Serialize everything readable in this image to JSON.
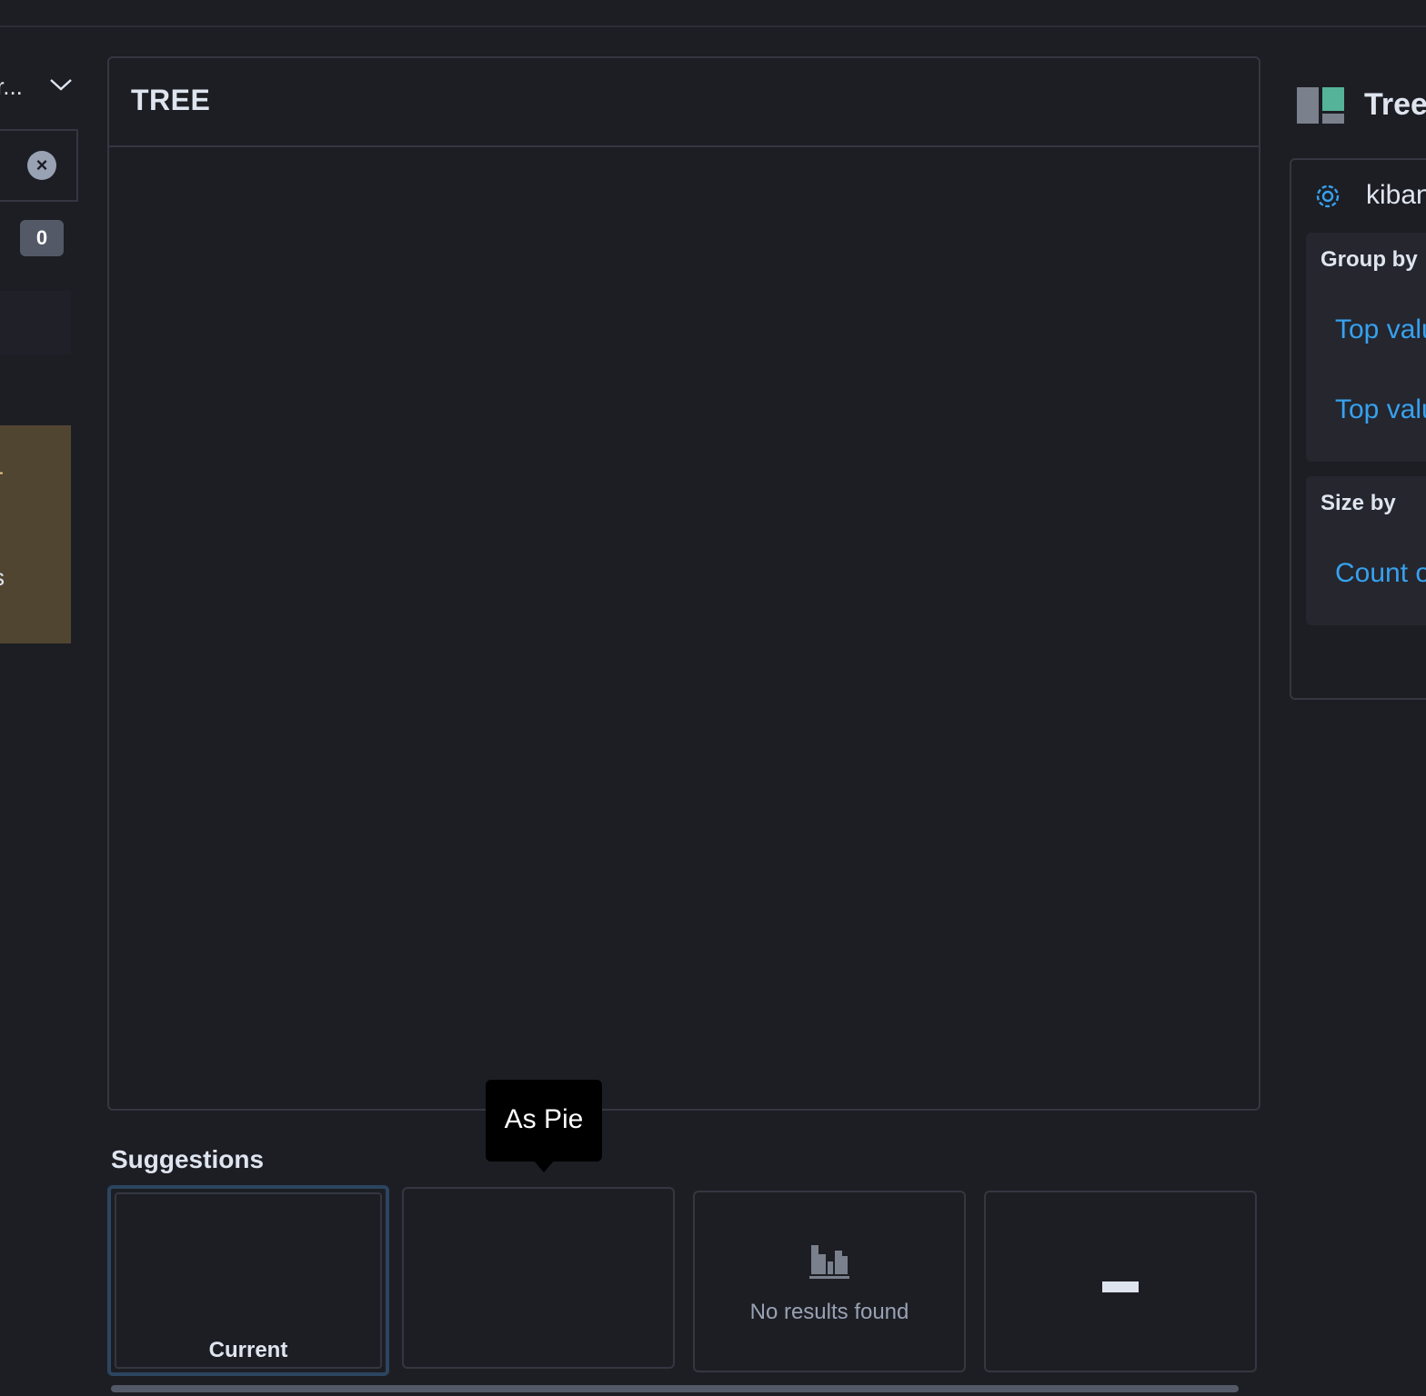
{
  "left_sidebar": {
    "data_view_select": "r...",
    "field_count": "0",
    "callout_mark": "-",
    "callout_text": "s"
  },
  "workspace": {
    "title": "TREE"
  },
  "tooltip": {
    "text": "As Pie"
  },
  "suggestions": {
    "title": "Suggestions",
    "current_label": "Current",
    "no_results": "No results found"
  },
  "config_panel": {
    "visualization_title": "Tree",
    "layer_name": "kiban",
    "group_by": {
      "label": "Group by",
      "items": [
        "Top valu",
        "Top valu"
      ]
    },
    "size_by": {
      "label": "Size by",
      "items": [
        "Count o"
      ]
    }
  },
  "colors": {
    "background": "#1d1e24",
    "border": "#343741",
    "link": "#36a2ef",
    "callout": "#504531",
    "selected_outline": "#2c4560",
    "treemap_accent": "#54b399"
  },
  "icons": [
    "chevron-down-icon",
    "clear-icon",
    "treemap-icon",
    "gear-icon",
    "empty-chart-icon",
    "dash-icon"
  ]
}
